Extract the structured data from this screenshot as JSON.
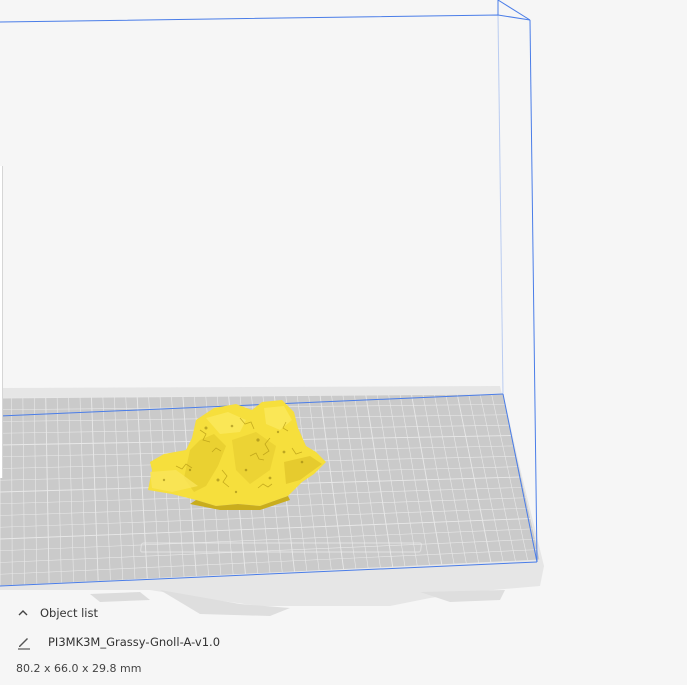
{
  "object_list": {
    "title": "Object list",
    "item_name": "PI3MK3M_Grassy-Gnoll-A-v1.0",
    "dimensions": "80.2 x 66.0 x 29.8 mm"
  },
  "icons": {
    "collapse": "chevron-up-icon",
    "edit": "pencil-icon"
  },
  "colors": {
    "build_volume_line": "#4a7de8",
    "build_plate": "#c9c9c9",
    "grid_line": "#e8e8e8",
    "model": "#f6df3c",
    "model_shadow": "#c9ad1d"
  }
}
